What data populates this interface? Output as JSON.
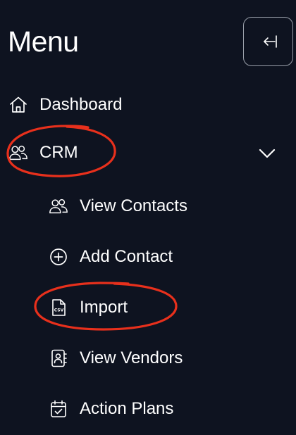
{
  "header": {
    "title": "Menu"
  },
  "nav": {
    "dashboard": {
      "label": "Dashboard",
      "icon": "home-icon"
    },
    "crm": {
      "label": "CRM",
      "icon": "users-icon",
      "expanded": true,
      "children": [
        {
          "label": "View Contacts",
          "icon": "users-icon"
        },
        {
          "label": "Add Contact",
          "icon": "plus-circle-icon"
        },
        {
          "label": "Import",
          "icon": "csv-file-icon"
        },
        {
          "label": "View Vendors",
          "icon": "contact-book-icon"
        },
        {
          "label": "Action Plans",
          "icon": "calendar-check-icon"
        }
      ]
    }
  },
  "colors": {
    "background": "#0e1320",
    "text": "#ffffff",
    "annotation": "#e8301c",
    "button_border": "#9aa0aa"
  }
}
